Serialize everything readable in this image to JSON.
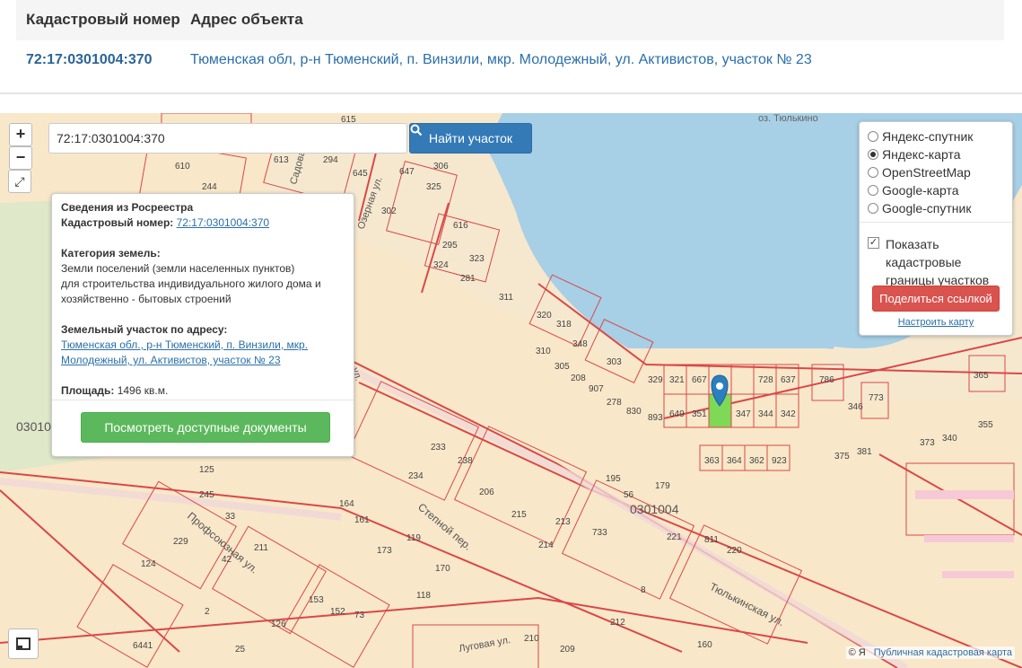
{
  "table": {
    "col1_header": "Кадастровый номер",
    "col2_header": "Адрес объекта",
    "cadastral_number": "72:17:0301004:370",
    "address": "Тюменская обл, р-н Тюменский, п. Винзили, мкр. Молодежный, ул. Активистов, участок № 23"
  },
  "map": {
    "zoom_in": "+",
    "zoom_out": "−",
    "search_value": "72:17:0301004:370",
    "search_button": "Найти участок",
    "lake_label": "оз. Тюлькино",
    "quarter_label_left": "03010",
    "quarter_label_center": "0301004",
    "streets": [
      "Садовая ул.",
      "Озерная ул.",
      "Профсоюзная ул.",
      "Степной пер.",
      "Тюлькинская ул.",
      "Луговая ул.",
      "ул."
    ],
    "parcel_numbers": [
      "615",
      "613",
      "294",
      "645",
      "647",
      "306",
      "325",
      "610",
      "244",
      "302",
      "616",
      "295",
      "323",
      "324",
      "281",
      "311",
      "320",
      "318",
      "310",
      "348",
      "305",
      "208",
      "303",
      "907",
      "278",
      "830",
      "893",
      "649",
      "351",
      "347",
      "344",
      "342",
      "329",
      "321",
      "667",
      "728",
      "637",
      "786",
      "346",
      "773",
      "365",
      "373",
      "340",
      "355",
      "375",
      "381",
      "363",
      "364",
      "362",
      "923",
      "195",
      "179",
      "56",
      "221",
      "124",
      "811",
      "220",
      "733",
      "210",
      "209",
      "126",
      "25",
      "229",
      "125",
      "245",
      "33",
      "211",
      "42",
      "164",
      "161",
      "233",
      "234",
      "238",
      "206",
      "215",
      "213",
      "214",
      "173",
      "119",
      "170",
      "118",
      "153",
      "152",
      "73",
      "160",
      "212",
      "8",
      "2",
      "6441"
    ],
    "popup": {
      "title": "Сведения из Росреестра",
      "cad_label": "Кадастровый номер:",
      "cad_value": "72:17:0301004:370",
      "category_label": "Категория земель:",
      "category_value_1": "Земли поселений (земли населенных пунктов)",
      "category_value_2": "для строительства индивидуального жилого дома и",
      "category_value_3": "хозяйственно - бытовых строений",
      "address_label": "Земельный участок по адресу:",
      "address_value_1": "Тюменская обл., р-н Тюменский, п. Винзили, мкр.",
      "address_value_2": "Молодежный, ул. Активистов, участок № 23",
      "area_label": "Площадь:",
      "area_value": "1496 кв.м.",
      "docs_button": "Посмотреть доступные документы"
    },
    "layers": {
      "options": [
        "Яндекс-спутник",
        "Яндекс-карта",
        "OpenStreetMap",
        "Google-карта",
        "Google-спутник"
      ],
      "selected": "Яндекс-карта",
      "show_boundaries_line1": "Показать",
      "show_boundaries_line2": "кадастровые",
      "show_boundaries_line3": "границы участков",
      "share_button": "Поделиться ссылкой",
      "configure_link": "Настроить карту"
    },
    "attribution": "Публичная кадастровая карта",
    "copyright": "© Я"
  },
  "colors": {
    "land": "#f8e7c9",
    "water": "#a7cfe6",
    "sand": "#f6e8cf",
    "parcel_line": "#d94848",
    "selected_parcel": "#7ed957",
    "link": "#2a6fa8"
  }
}
